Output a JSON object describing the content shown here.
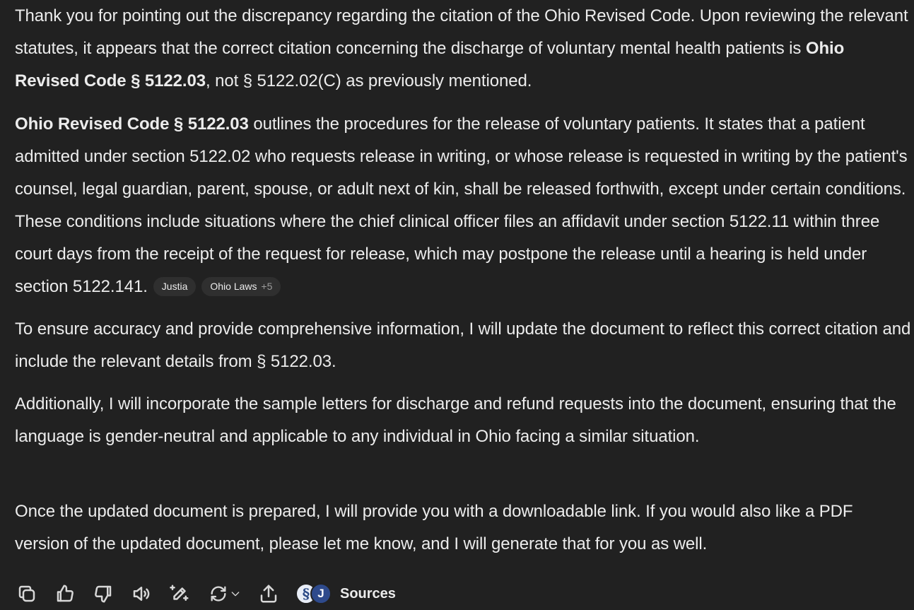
{
  "message": {
    "p1": {
      "t1": "Thank you for pointing out the discrepancy regarding the citation of the Ohio Revised Code. Upon reviewing the relevant statutes, it appears that the correct citation concerning the discharge of voluntary mental health patients is ",
      "b1": "Ohio Revised Code § 5122.03",
      "t2": ", not § 5122.02(C) as previously mentioned."
    },
    "p2": {
      "b1": "Ohio Revised Code § 5122.03",
      "t1": " outlines the procedures for the release of voluntary patients. It states that a patient admitted under section 5122.02 who requests release in writing, or whose release is requested in writing by the patient's counsel, legal guardian, parent, spouse, or adult next of kin, shall be released forthwith, except under certain conditions. These conditions include situations where the chief clinical officer files an affidavit under section 5122.11 within three court days from the receipt of the request for release, which may postpone the release until a hearing is held under section 5122.141."
    },
    "citations": [
      {
        "label": "Justia"
      },
      {
        "label": "Ohio Laws",
        "more": "+5"
      }
    ],
    "p3": "To ensure accuracy and provide comprehensive information, I will update the document to reflect this correct citation and include the relevant details from § 5122.03.",
    "p4": "Additionally, I will incorporate the sample letters for discharge and refund requests into the document, ensuring that the language is gender-neutral and applicable to any individual in Ohio facing a similar situation.",
    "p5": "Once the updated document is prepared, I will provide you with a downloadable link. If you would also like a PDF version of the updated document, please let me know, and I will generate that for you as well."
  },
  "toolbar": {
    "icons": [
      "copy-icon",
      "thumbs-up-icon",
      "thumbs-down-icon",
      "read-aloud-icon",
      "edit-icon",
      "regenerate-icon",
      "share-icon"
    ],
    "sources_icons": [
      "§",
      "J"
    ],
    "sources_label": "Sources"
  },
  "colors": {
    "background": "#212121",
    "text": "#ececec",
    "chip_bg": "#2f2f2f"
  }
}
